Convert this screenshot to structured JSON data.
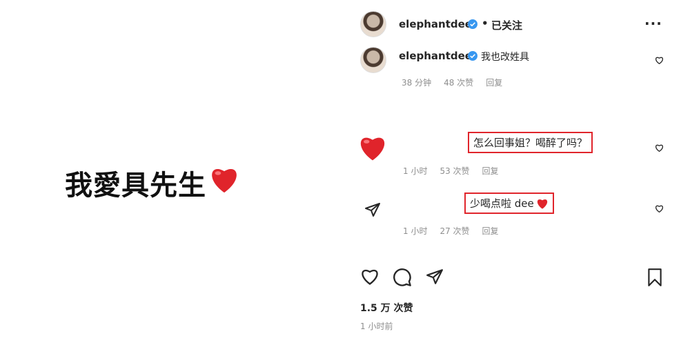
{
  "image": {
    "caption": "我愛具先生"
  },
  "header": {
    "username": "elephantdee",
    "separator": "•",
    "follow_status": "已关注",
    "more": "···"
  },
  "caption_comment": {
    "username": "elephantdee",
    "text": "我也改姓具",
    "time": "38 分钟",
    "likes": "48 次赞",
    "reply": "回复"
  },
  "comments": [
    {
      "text": "怎么回事姐？喝醉了吗？",
      "time": "1 小时",
      "likes": "53 次赞",
      "reply": "回复"
    },
    {
      "text": "少喝点啦 dee",
      "time": "1 小时",
      "likes": "27 次赞",
      "reply": "回复"
    }
  ],
  "post": {
    "likes": "1.5 万 次赞",
    "time": "1 小时前"
  },
  "colors": {
    "highlight": "#e0242b",
    "verified": "#3897f0",
    "heart": "#e0242b",
    "muted": "#8e8e8e"
  }
}
